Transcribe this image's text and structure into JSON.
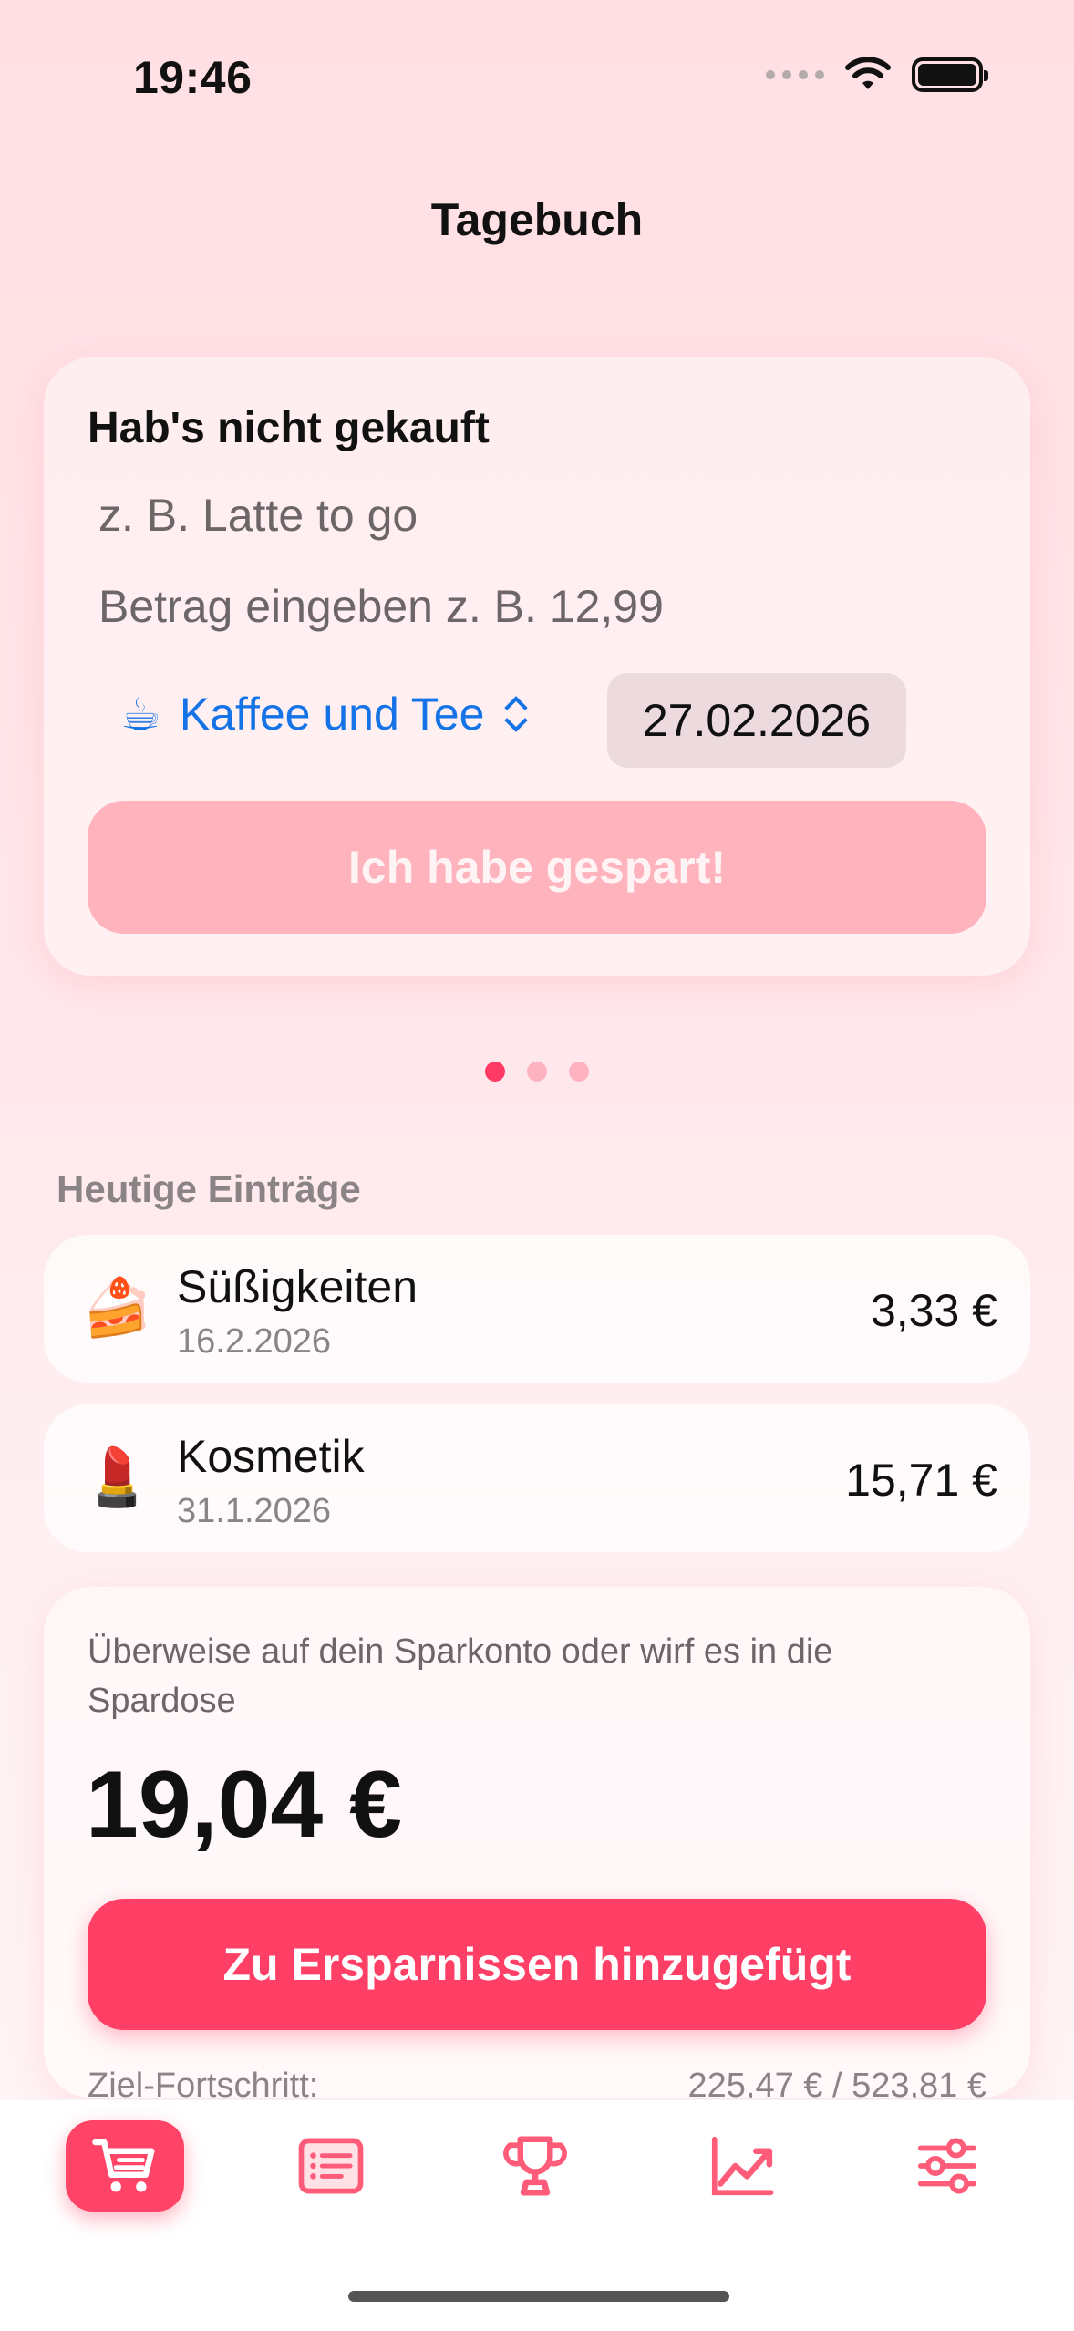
{
  "status": {
    "time": "19:46"
  },
  "header": {
    "title": "Tagebuch"
  },
  "entry_form": {
    "heading": "Hab's nicht gekauft",
    "name_placeholder": "z. B. Latte to go",
    "amount_placeholder": "Betrag eingeben z. B. 12,99",
    "category_emoji": "☕",
    "category_label": "Kaffee und Tee",
    "date": "27.02.2026",
    "submit_label": "Ich habe gespart!"
  },
  "section": {
    "title": "Heutige Einträge"
  },
  "entries": [
    {
      "emoji": "🍰",
      "name": "Süßigkeiten",
      "date": "16.2.2026",
      "amount": "3,33 €"
    },
    {
      "emoji": "💄",
      "name": "Kosmetik",
      "date": "31.1.2026",
      "amount": "15,71 €"
    }
  ],
  "summary": {
    "hint": "Überweise auf dein Sparkonto oder wirf es in die Spardose",
    "total": "19,04 €",
    "button_label": "Zu Ersparnissen hinzugefügt",
    "progress_label": "Ziel-Fortschritt:",
    "progress_value": "225,47 € / 523,81 €"
  },
  "tabs": [
    "cart-icon",
    "list-icon",
    "trophy-icon",
    "chart-icon",
    "sliders-icon"
  ],
  "colors": {
    "accent": "#ff3f66",
    "link": "#1473e6",
    "disabled": "#ffb3bd"
  }
}
